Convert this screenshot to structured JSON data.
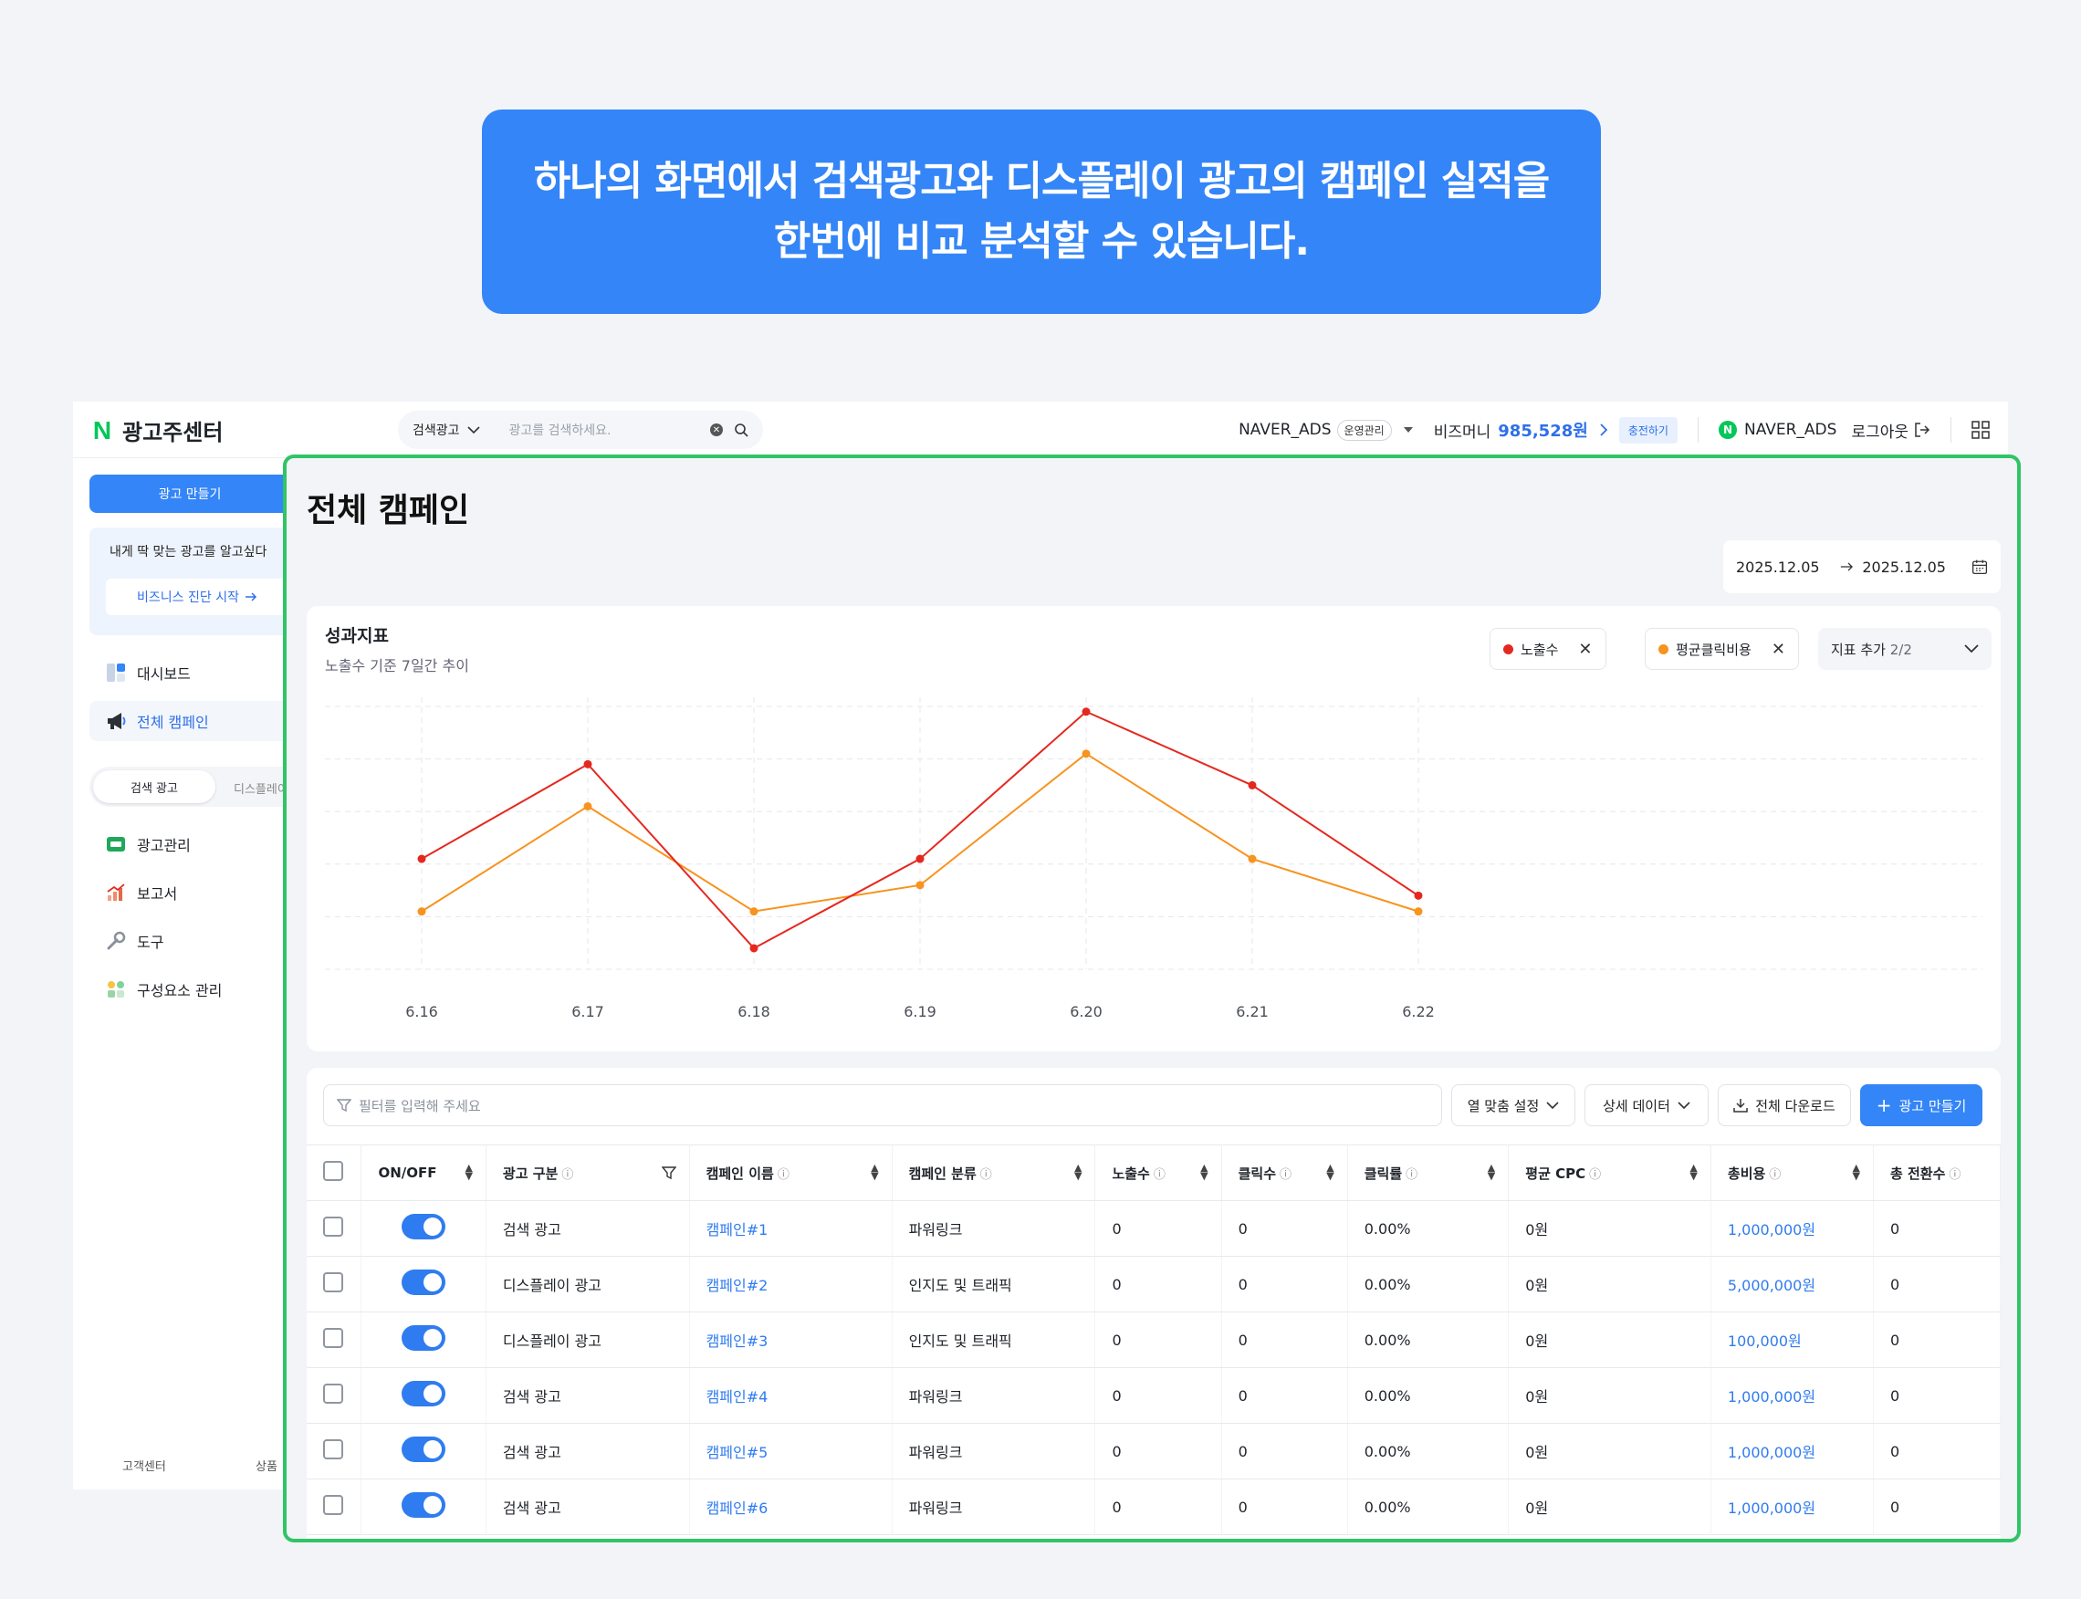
{
  "banner": {
    "line1": "하나의 화면에서 검색광고와 디스플레이 광고의 캠페인 실적을",
    "line2": "한번에 비교 분석할 수 있습니다."
  },
  "topbar": {
    "logo_text": "광고주센터",
    "search_category": "검색광고",
    "search_placeholder": "광고를 검색하세요.",
    "account": "NAVER_ADS",
    "account_badge": "운영관리",
    "bizmoney_label": "비즈머니",
    "bizmoney_amount": "985,528원",
    "charge_label": "충전하기",
    "user": "NAVER_ADS",
    "logout": "로그아웃"
  },
  "sidebar": {
    "make_ad": "광고 만들기",
    "promo_title": "내게 딱 맞는 광고를 알고싶다",
    "promo_button": "비즈니스 진단 시작",
    "items": [
      {
        "label": "대시보드",
        "icon": "dashboard-icon"
      },
      {
        "label": "전체 캠페인",
        "icon": "megaphone-icon"
      }
    ],
    "seg_active": "검색 광고",
    "seg_other": "디스플레이",
    "sub_items": [
      {
        "label": "광고관리",
        "icon": "ad-manage-icon"
      },
      {
        "label": "보고서",
        "icon": "report-icon"
      },
      {
        "label": "도구",
        "icon": "tool-icon"
      },
      {
        "label": "구성요소 관리",
        "icon": "components-icon"
      }
    ],
    "footer": [
      "고객센터",
      "상품"
    ]
  },
  "panel": {
    "title": "전체 캠페인",
    "date_from": "2025.12.05",
    "date_to": "2025.12.05"
  },
  "chart_card": {
    "title": "성과지표",
    "subtitle": "노출수 기준 7일간 추이",
    "chips": [
      "노출수",
      "평균클릭비용"
    ],
    "add_label": "지표 추가",
    "add_count": "2/2"
  },
  "chart_data": {
    "type": "line",
    "x": [
      "6.16",
      "6.17",
      "6.18",
      "6.19",
      "6.20",
      "6.21",
      "6.22"
    ],
    "ylim": [
      0,
      5
    ],
    "grid": true,
    "series": [
      {
        "name": "노출수",
        "color": "#e5281f",
        "values": [
          2.1,
          3.9,
          0.4,
          2.1,
          4.9,
          3.5,
          1.4
        ]
      },
      {
        "name": "평균클릭비용",
        "color": "#f7931e",
        "values": [
          1.1,
          3.1,
          1.1,
          1.6,
          4.1,
          2.1,
          1.1
        ]
      }
    ]
  },
  "table_card": {
    "filter_placeholder": "필터를 입력해 주세요",
    "btn_columns": "열 맞춤 설정",
    "btn_detail": "상세 데이터",
    "btn_download": "전체 다운로드",
    "btn_make": "광고 만들기",
    "headers": [
      "ON/OFF",
      "광고 구분",
      "캠페인 이름",
      "캠페인 분류",
      "노출수",
      "클릭수",
      "클릭률",
      "평균 CPC",
      "총비용",
      "총 전환수"
    ],
    "rows": [
      [
        "검색 광고",
        "캠페인#1",
        "파워링크",
        "0",
        "0",
        "0.00%",
        "0원",
        "1,000,000원",
        "0"
      ],
      [
        "디스플레이 광고",
        "캠페인#2",
        "인지도 및 트래픽",
        "0",
        "0",
        "0.00%",
        "0원",
        "5,000,000원",
        "0"
      ],
      [
        "디스플레이 광고",
        "캠페인#3",
        "인지도 및 트래픽",
        "0",
        "0",
        "0.00%",
        "0원",
        "100,000원",
        "0"
      ],
      [
        "검색 광고",
        "캠페인#4",
        "파워링크",
        "0",
        "0",
        "0.00%",
        "0원",
        "1,000,000원",
        "0"
      ],
      [
        "검색 광고",
        "캠페인#5",
        "파워링크",
        "0",
        "0",
        "0.00%",
        "0원",
        "1,000,000원",
        "0"
      ],
      [
        "검색 광고",
        "캠페인#6",
        "파워링크",
        "0",
        "0",
        "0.00%",
        "0원",
        "1,000,000원",
        "0"
      ]
    ]
  }
}
